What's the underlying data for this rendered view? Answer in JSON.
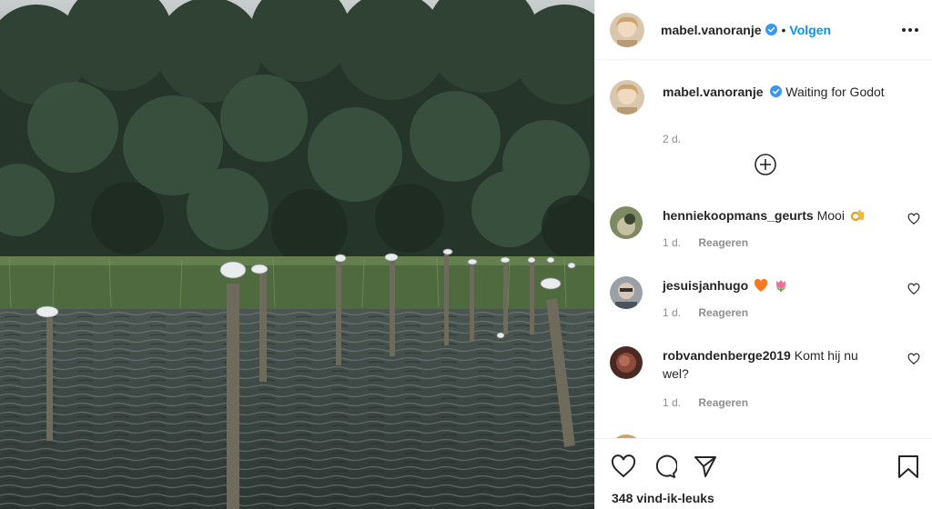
{
  "post": {
    "username": "mabel.vanoranje",
    "follow_dot": "•",
    "follow_label": "Volgen"
  },
  "caption": {
    "username": "mabel.vanoranje",
    "text": "Waiting for Godot",
    "time": "2 d."
  },
  "comments": [
    {
      "username": "henniekoopmans_geurts",
      "text": "Mooi",
      "emoji": "ok-hand",
      "time": "1 d.",
      "reply_label": "Reageren"
    },
    {
      "username": "jesuisjanhugo",
      "text": "",
      "emoji": "orange-heart tulip",
      "time": "1 d.",
      "reply_label": "Reageren"
    },
    {
      "username": "robvandenberge2019",
      "text": "Komt hij nu wel?",
      "emoji": "",
      "time": "1 d.",
      "reply_label": "Reageren"
    }
  ],
  "likes": "348 vind-ik-leuks",
  "colors": {
    "accent": "#0095f6",
    "text": "#262626",
    "muted": "#8e8e8e",
    "verified": "#3897f0"
  },
  "icons": [
    "verified-badge-icon",
    "more-options-icon",
    "load-more-icon",
    "heart-icon",
    "comment-icon",
    "share-icon",
    "bookmark-icon"
  ]
}
